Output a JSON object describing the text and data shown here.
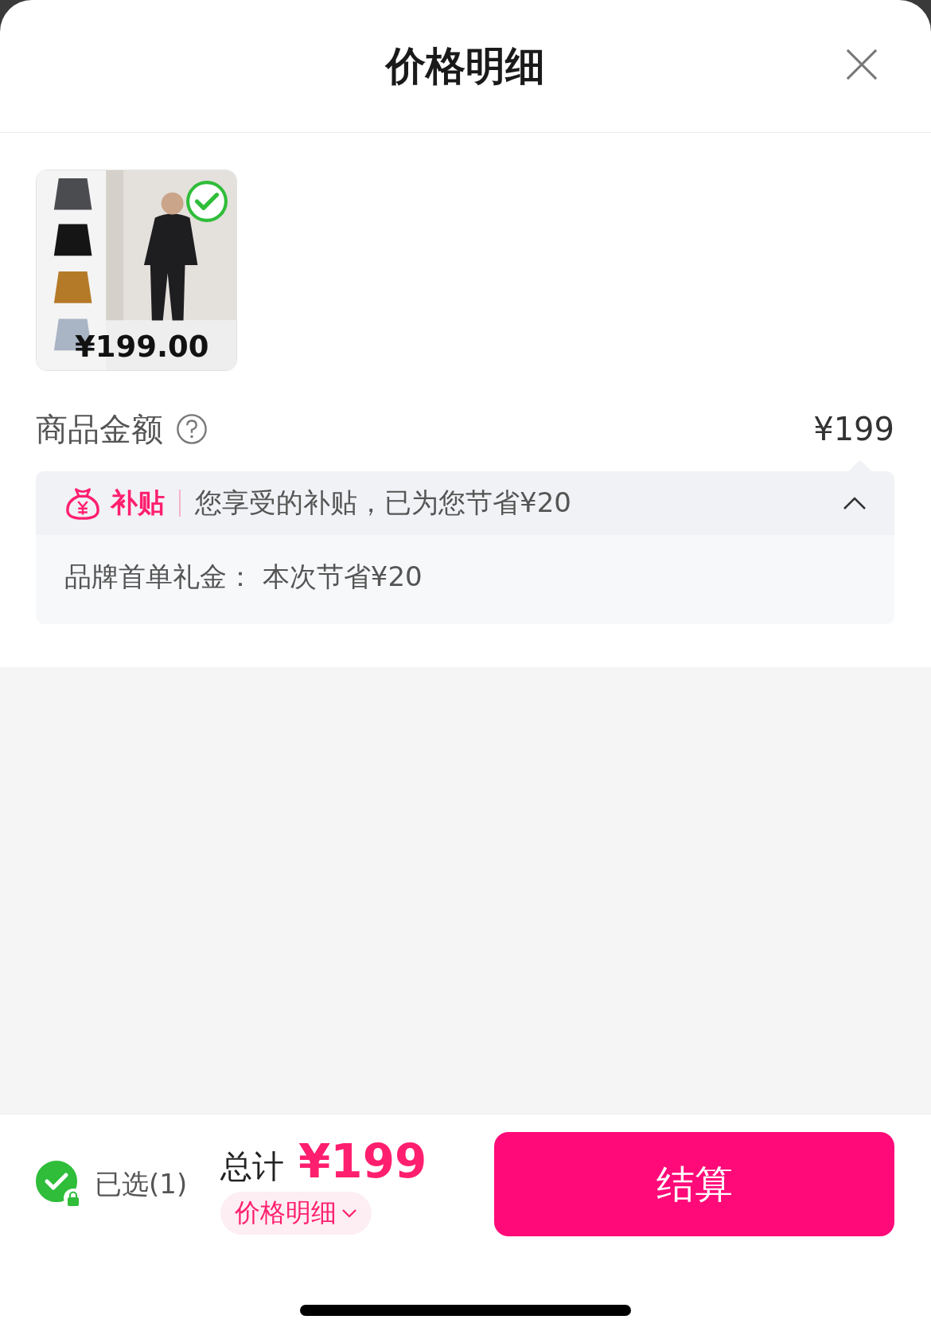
{
  "sheet": {
    "title": "价格明细"
  },
  "product": {
    "kind": "picture",
    "price": "¥199.00",
    "selected": true
  },
  "amount": {
    "label": "商品金额",
    "value": "¥199"
  },
  "subsidy": {
    "tag": "补贴",
    "summary": "您享受的补贴，已为您节省¥20",
    "expanded": true,
    "details": [
      {
        "text": "品牌首单礼金：  本次节省¥20"
      }
    ]
  },
  "footer": {
    "select_label": "已选(1)",
    "checked": true,
    "total_label": "总计",
    "total": "¥199",
    "detail_link": "价格明细",
    "detail_expanded": false,
    "checkout": "结算"
  }
}
